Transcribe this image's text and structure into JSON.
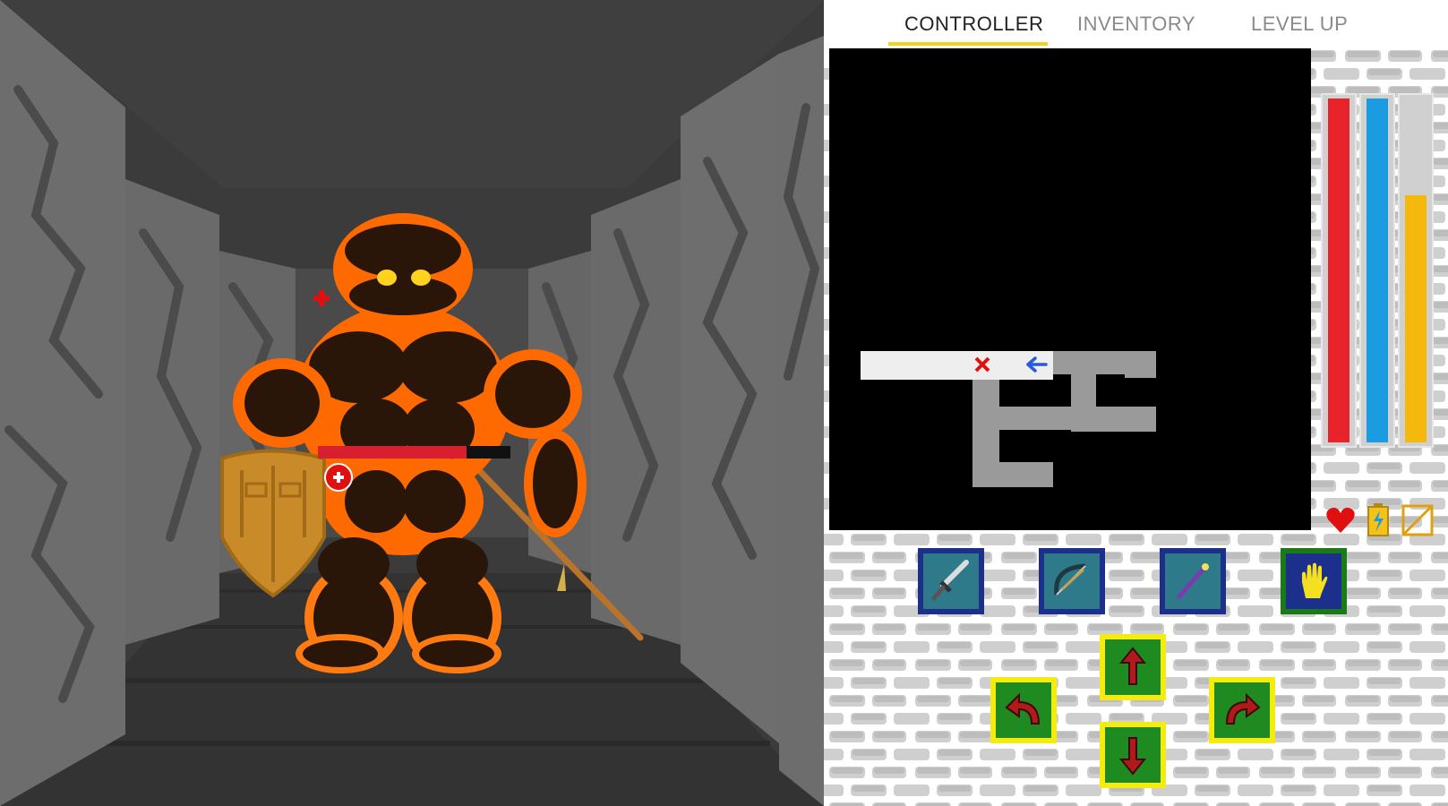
{
  "tabs": [
    {
      "label": "CONTROLLER",
      "active": true
    },
    {
      "label": "INVENTORY",
      "active": false
    },
    {
      "label": "LEVEL UP",
      "active": false
    }
  ],
  "colors": {
    "tab_accent": "#f3d21b",
    "health": "#e8242a",
    "mana": "#1b9be0",
    "stamina": "#f5b80d",
    "attack_btn_bg": "#1c2f8a",
    "action_btn_bg": "#1a7a1a",
    "move_btn_bg": "#f4ec10",
    "move_btn_inner": "#1f8a1f",
    "arrow": "#b01a1a",
    "lava": "#ff6a00",
    "rock": "#2a1608"
  },
  "stats": {
    "health_fraction": 1.0,
    "mana_fraction": 1.0,
    "stamina_fraction": 0.72
  },
  "enemy": {
    "type": "lava-golem",
    "health_fraction": 0.77
  },
  "minimap": {
    "player_marker": "blue-arrow-left",
    "target_marker": "red-x"
  },
  "stat_icons": [
    "heart-icon",
    "battery-icon",
    "slash-box-icon"
  ],
  "attack_buttons": [
    {
      "name": "sword-attack-button",
      "icon": "sword-icon"
    },
    {
      "name": "bow-attack-button",
      "icon": "bow-icon"
    },
    {
      "name": "wand-attack-button",
      "icon": "wand-icon"
    },
    {
      "name": "hand-interact-button",
      "icon": "hand-icon"
    }
  ],
  "movement_buttons": [
    "move-forward-button",
    "turn-left-button",
    "turn-right-button",
    "move-back-button"
  ]
}
